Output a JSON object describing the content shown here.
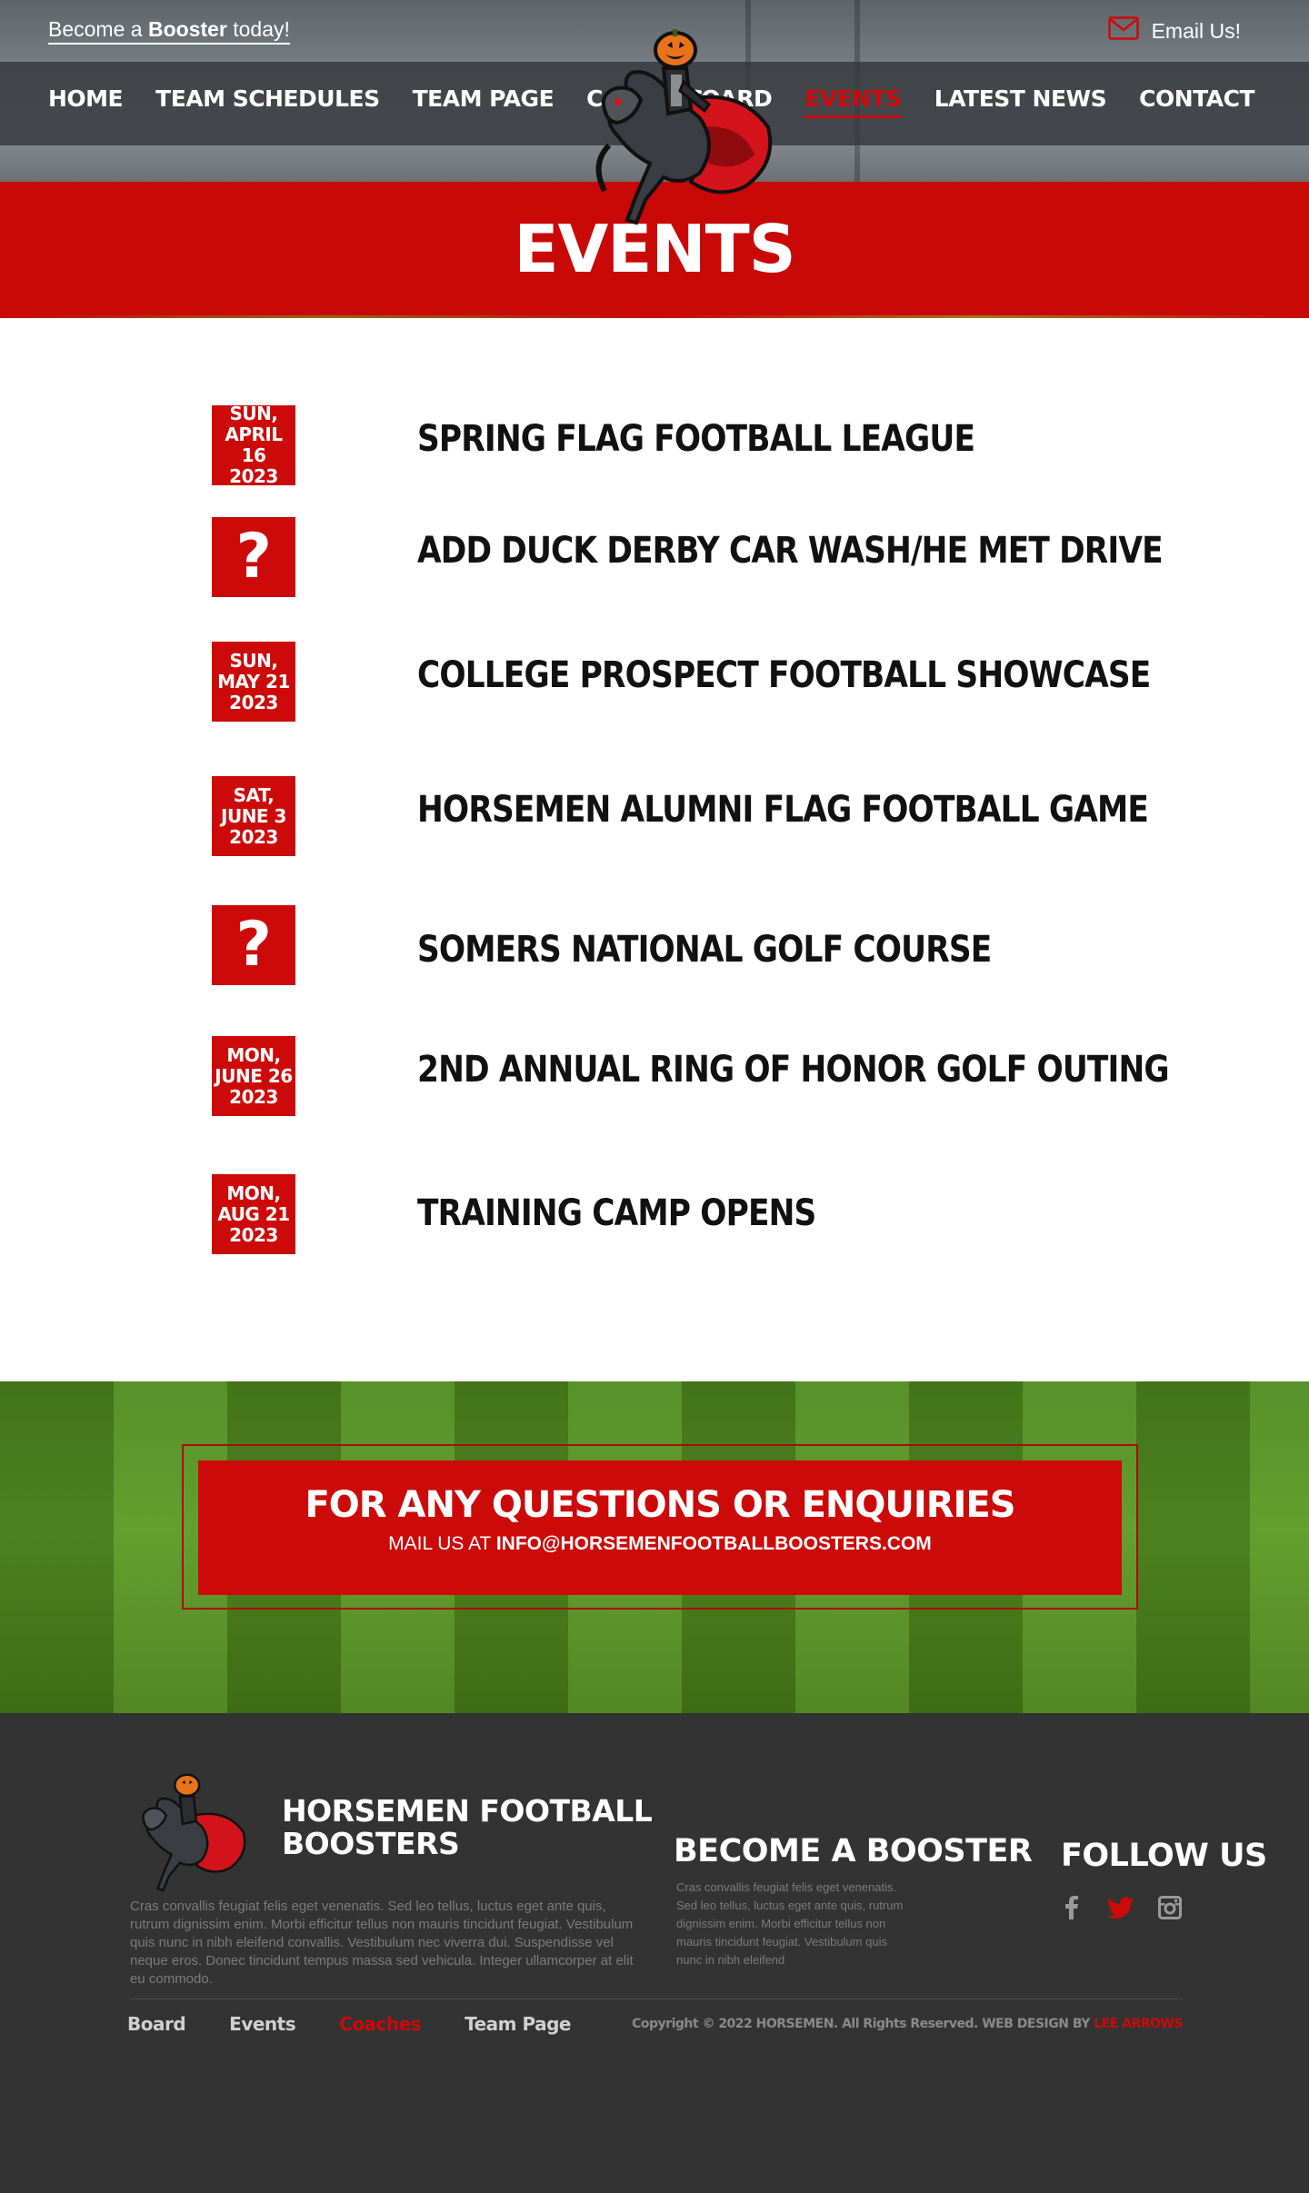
{
  "topbar": {
    "booster_prefix": "Become a ",
    "booster_bold": "Booster",
    "booster_suffix": " today!",
    "email_label": "Email Us!"
  },
  "nav": {
    "left": [
      "HOME",
      "TEAM SCHEDULES",
      "TEAM PAGE",
      "COACHES"
    ],
    "right": [
      "BOARD",
      "EVENTS",
      "LATEST NEWS",
      "CONTACT"
    ],
    "active": "EVENTS"
  },
  "page": {
    "title": "EVENTS"
  },
  "events": [
    {
      "date_line1": "SUN,",
      "date_line2": "APRIL 16",
      "date_line3": "2023",
      "title": "SPRING FLAG FOOTBALL LEAGUE"
    },
    {
      "date_line1": "?",
      "date_line2": "",
      "date_line3": "",
      "title": "ADD DUCK DERBY CAR WASH/HE MET DRIVE"
    },
    {
      "date_line1": "SUN,",
      "date_line2": "MAY 21",
      "date_line3": "2023",
      "title": "COLLEGE PROSPECT FOOTBALL SHOWCASE"
    },
    {
      "date_line1": "SAT,",
      "date_line2": "JUNE 3",
      "date_line3": "2023",
      "title": "HORSEMEN ALUMNI FLAG FOOTBALL GAME"
    },
    {
      "date_line1": "?",
      "date_line2": "",
      "date_line3": "",
      "title": "SOMERS NATIONAL GOLF COURSE"
    },
    {
      "date_line1": "MON,",
      "date_line2": "JUNE 26",
      "date_line3": "2023",
      "title": "2ND ANNUAL RING OF HONOR GOLF OUTING"
    },
    {
      "date_line1": "MON,",
      "date_line2": "AUG 21",
      "date_line3": "2023",
      "title": "TRAINING CAMP OPENS"
    }
  ],
  "cta": {
    "title": "FOR ANY QUESTIONS OR ENQUIRIES",
    "mail_prefix": "MAIL US AT ",
    "mail_address": "INFO@HORSEMENFOOTBALLBOOSTERS.COM"
  },
  "footer": {
    "brand_line1": "HORSEMEN FOOTBALL",
    "brand_line2": "BOOSTERS",
    "about_text": "Cras convallis feugiat felis eget venenatis. Sed leo tellus, luctus eget ante quis, rutrum dignissim enim. Morbi efficitur tellus non mauris tincidunt feugiat. Vestibulum quis nunc in nibh eleifend convallis. Vestibulum nec viverra dui. Suspendisse vel neque eros. Donec tincidunt tempus massa sed vehicula. Integer ullamcorper at elit eu commodo.",
    "booster_heading": "BECOME A BOOSTER",
    "booster_text": "Cras convallis feugiat felis eget venenatis. Sed leo tellus, luctus eget ante quis, rutrum dignissim enim. Morbi efficitur tellus non mauris tincidunt feugiat. Vestibulum quis nunc in nibh eleifend",
    "follow_heading": "FOLLOW US",
    "social_icons": [
      "facebook-icon",
      "twitter-icon",
      "instagram-icon"
    ],
    "links": [
      "Board",
      "Events",
      "Coaches",
      "Team Page"
    ],
    "active_link": "Coaches",
    "copyright": "Copyright © 2022 HORSEMEN. All Rights Reserved. WEB DESIGN BY ",
    "credit": "LEE ARROWS"
  },
  "colors": {
    "brand_red": "#cc0a0a",
    "footer_bg": "#333333",
    "nav_bg": "#34373a",
    "field_green": "#5c9a24"
  }
}
